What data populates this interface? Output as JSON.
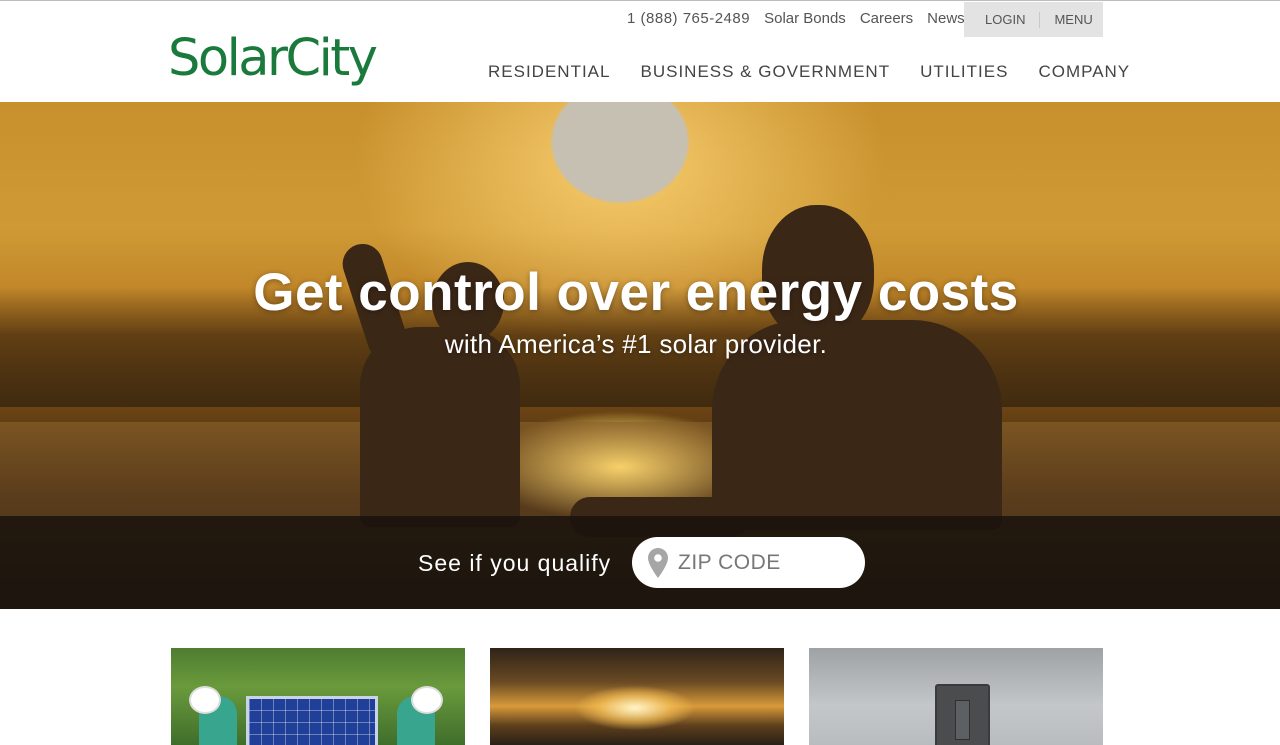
{
  "brand": {
    "logo_text": "SolarCity",
    "logo_color": "#1a7a3c"
  },
  "utility_nav": {
    "phone": "1 (888) 765-2489",
    "links": [
      "Solar Bonds",
      "Careers",
      "News"
    ],
    "login_label": "LOGIN",
    "menu_label": "MENU"
  },
  "main_nav": {
    "items": [
      "RESIDENTIAL",
      "BUSINESS & GOVERNMENT",
      "UTILITIES",
      "COMPANY"
    ]
  },
  "hero": {
    "title": "Get control over energy costs",
    "subtitle": "with America’s #1 solar provider."
  },
  "qualify": {
    "label": "See if you qualify",
    "zip_placeholder": "ZIP CODE",
    "zip_value": "",
    "pin_icon": "location-pin-icon"
  },
  "cards": [
    {
      "image": "solar-panel-installers"
    },
    {
      "image": "sunset-clouds"
    },
    {
      "image": "light-switch"
    }
  ]
}
